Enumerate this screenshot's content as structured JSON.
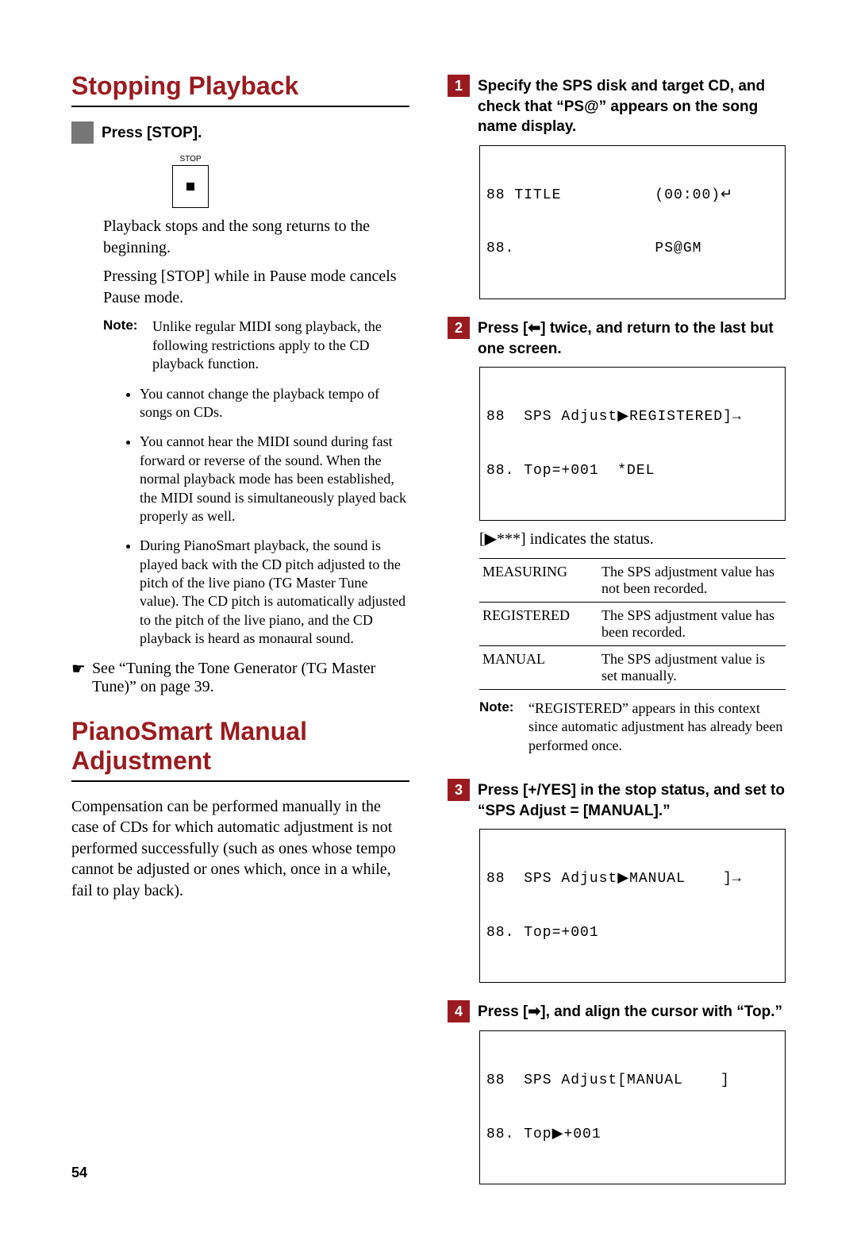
{
  "page_number": "54",
  "left": {
    "title1": "Stopping Playback",
    "step0_title": "Press [STOP].",
    "stop_label": "STOP",
    "p1": "Playback stops and the song returns to the beginning.",
    "p2": "Pressing [STOP] while in Pause mode cancels Pause mode.",
    "note_label": "Note:",
    "note_intro": "Unlike regular MIDI song playback, the following restrictions apply to the CD playback function.",
    "bullets": [
      "You cannot change the playback tempo of songs on CDs.",
      "You cannot hear the MIDI sound during fast forward or reverse of the sound.  When the normal playback mode has been established, the MIDI sound is simultaneously played back properly as well.",
      "During PianoSmart playback, the sound is played back with the CD pitch adjusted to the pitch of the live piano (TG Master Tune value).  The CD pitch is automatically adjusted to the pitch of the live piano, and the CD playback is heard as monaural sound."
    ],
    "see": "See “Tuning the Tone Generator (TG Master Tune)” on page 39.",
    "title2": "PianoSmart Manual Adjustment",
    "p3": "Compensation can be performed manually in the case of CDs for which automatic  adjustment is not performed successfully (such as ones whose tempo cannot be adjusted or ones which, once in a while, fail to play back)."
  },
  "right": {
    "steps": [
      {
        "n": "1",
        "title": "Specify the SPS disk and target CD, and check that “PS@” appears on the song name display.",
        "lcd_l1": "88 TITLE          (00:00)↵",
        "lcd_l2": "88.               PS@GM"
      },
      {
        "n": "2",
        "title": "Press [⬅] twice, and return to the last but one screen.",
        "lcd_l1": "88  SPS Adjust▶REGISTERED]→",
        "lcd_l2": "88. Top=+001  *DEL"
      },
      {
        "n": "3",
        "title": "Press [+/YES] in the stop status, and set to “SPS Adjust = [MANUAL].”",
        "lcd_l1": "88  SPS Adjust▶MANUAL    ]→",
        "lcd_l2": "88. Top=+001"
      },
      {
        "n": "4",
        "title": "Press [➡], and align the cursor with “Top.”",
        "lcd_l1": "88  SPS Adjust[MANUAL    ]",
        "lcd_l2": "88. Top▶+001"
      }
    ],
    "status_intro": "[▶***] indicates the status.",
    "status_table": [
      {
        "k": "MEASURING",
        "v": "The SPS adjustment value has not been recorded."
      },
      {
        "k": "REGISTERED",
        "v": "The SPS adjustment value has been recorded."
      },
      {
        "k": "MANUAL",
        "v": "The SPS adjustment value is set manually."
      }
    ],
    "note_label": "Note:",
    "note_text": "“REGISTERED” appears in this context since automatic adjustment has already been performed once."
  }
}
